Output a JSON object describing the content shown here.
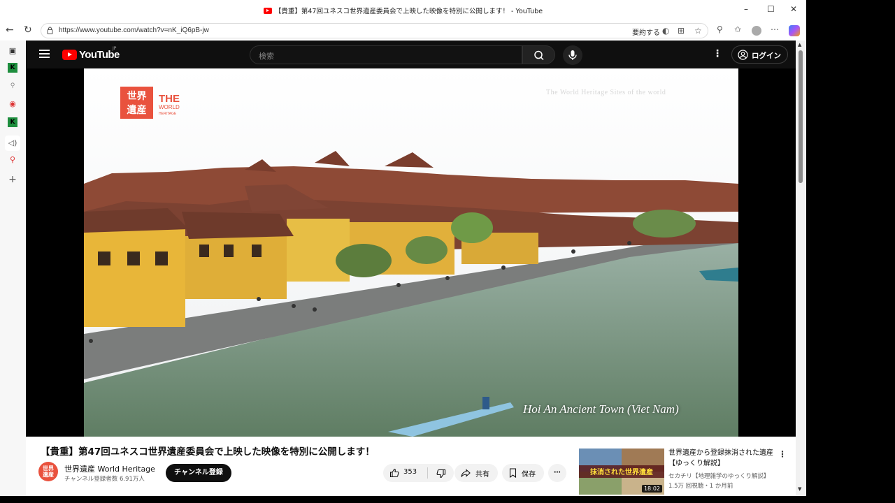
{
  "browser": {
    "window_title": "【貴重】第47回ユネスコ世界遺産委員会で上映した映像を特別に公開します！ - YouTube",
    "url": "https://www.youtube.com/watch?v=nK_iQ6pB-jw",
    "summarize_label": "要約する"
  },
  "header": {
    "logo_text": "YouTube",
    "logo_region": "JP",
    "search_placeholder": "検索",
    "login_label": "ログイン"
  },
  "player": {
    "overlay_title": "The World Heritage Sites of the world",
    "logo_kanji_top": "世界",
    "logo_kanji_bottom": "遺産",
    "logo_the": "THE",
    "logo_world": "WORLD",
    "logo_heritage": "HERITAGE",
    "caption": "Hoi An Ancient Town (Viet Nam)"
  },
  "video": {
    "title": "【貴重】第47回ユネスコ世界遺産委員会で上映した映像を特別に公開します！",
    "channel_name": "世界遺産 World Heritage",
    "subscribers": "チャンネル登録者数 6.91万人",
    "avatar_text": "世界遺産",
    "subscribe_label": "チャンネル登録",
    "likes": "353",
    "share_label": "共有",
    "save_label": "保存"
  },
  "recommended": {
    "title": "世界遺産から登録抹消された遺産【ゆっくり解説】",
    "channel": "セカチリ【地理雑学のゆっくり解説】",
    "meta": "1.5万 回視聴・1 か月前",
    "duration": "18:02",
    "thumb_text": "抹消された世界遺産"
  },
  "colors": {
    "yt_red": "#ff0000",
    "dark_bg": "#0f0f0f",
    "logo_red": "#e9523e"
  }
}
